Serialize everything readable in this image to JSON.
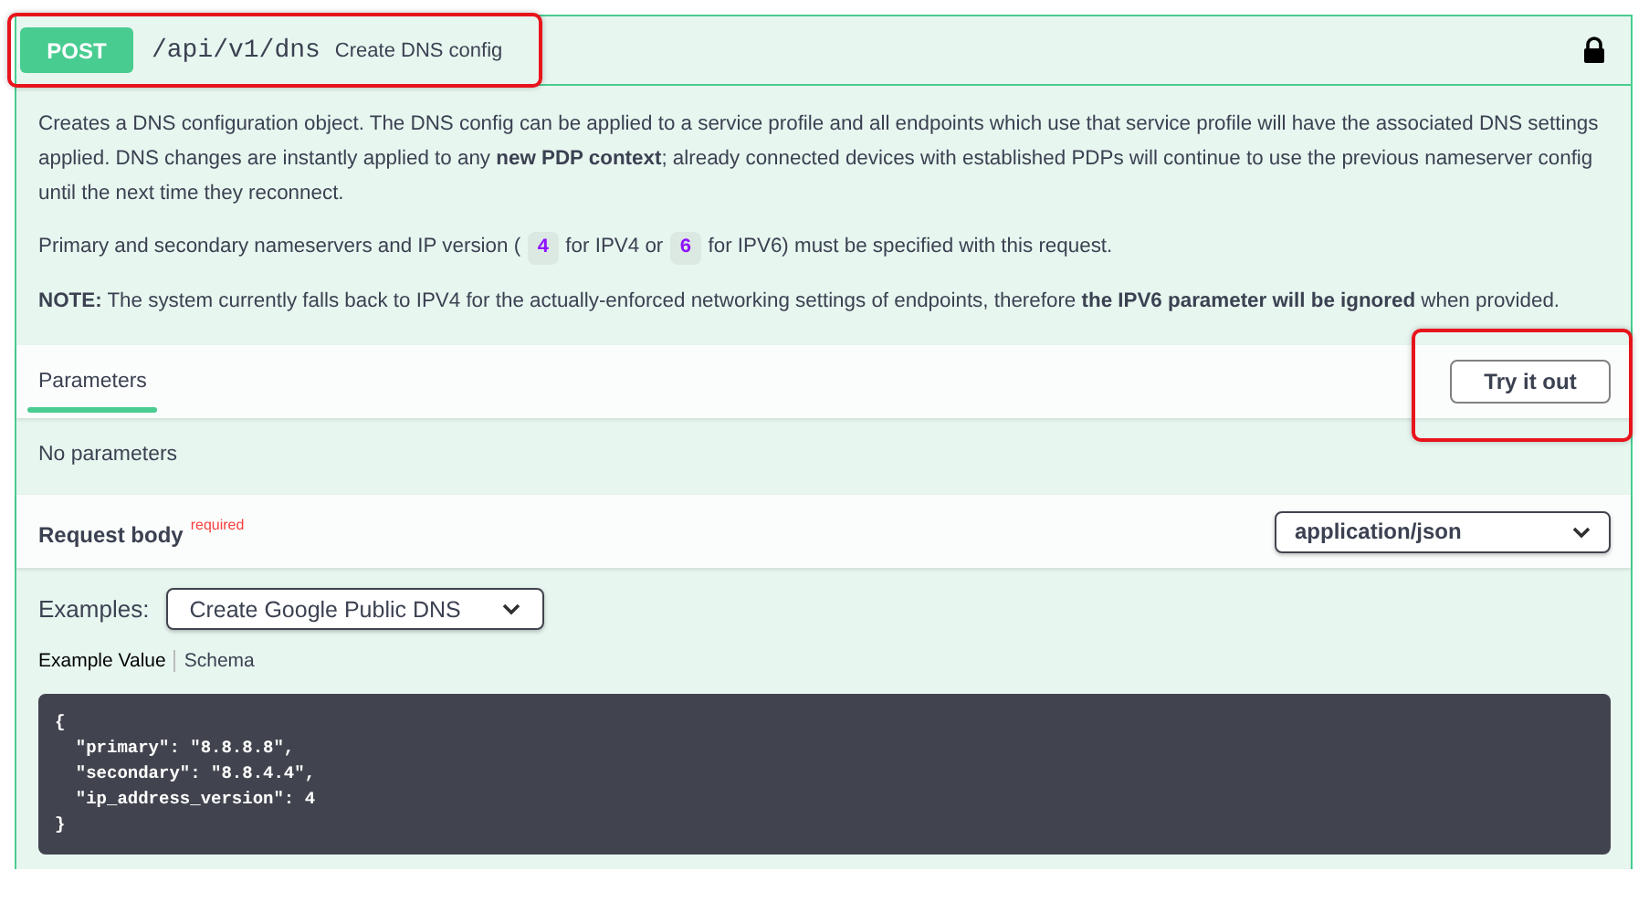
{
  "operation": {
    "method": "POST",
    "path": "/api/v1/dns",
    "summary": "Create DNS config",
    "locked": true,
    "highlighted": true
  },
  "description": [
    {
      "kind": "rich",
      "text": "Creates a DNS configuration object. The DNS config can be applied to a service profile and all endpoints which use that service profile will have the associated DNS settings applied. DNS changes are instantly applied to any **new PDP context**; already connected devices with established PDPs will continue to use the previous nameserver config until the next time they reconnect."
    },
    {
      "kind": "segments",
      "segments": [
        {
          "kind": "text",
          "text": "Primary and secondary nameservers and IP version ("
        },
        {
          "kind": "code",
          "text": "4"
        },
        {
          "kind": "text",
          "text": "for IPV4 or"
        },
        {
          "kind": "code",
          "text": "6"
        },
        {
          "kind": "text",
          "text": "for IPV6) must be specified with this request."
        }
      ]
    },
    {
      "kind": "rich",
      "text": "**NOTE:** The system currently falls back to IPV4 for the actually-enforced networking settings of endpoints, therefore **the IPV6 parameter will be ignored** when provided."
    }
  ],
  "parameters": {
    "tabs": [
      {
        "label": "Parameters",
        "selected": true
      }
    ],
    "try_button": {
      "label": "Try it out",
      "highlighted": true
    },
    "message": "No parameters"
  },
  "request_body": {
    "title": "Request body",
    "required_label": "required",
    "content_type": "application/json"
  },
  "examples": {
    "label": "Examples:",
    "selected_example": "Create Google Public DNS",
    "tabs": [
      {
        "label": "Example Value",
        "selected": true
      },
      {
        "label": "Schema",
        "selected": false
      }
    ],
    "code": "{\n  \"primary\": \"8.8.8.8\",\n  \"secondary\": \"8.8.4.4\",\n  \"ip_address_version\": 4\n}"
  }
}
